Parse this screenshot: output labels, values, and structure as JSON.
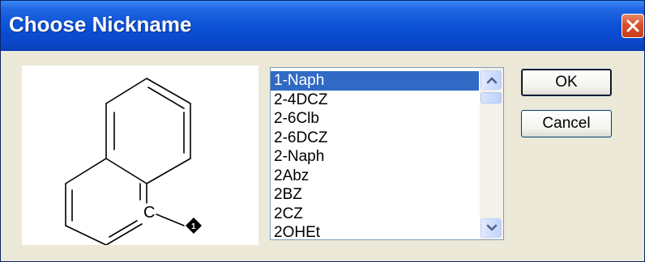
{
  "window": {
    "title": "Choose Nickname",
    "close_icon": "close-x-icon"
  },
  "preview": {
    "atom_label": "C",
    "attachment_marker": "1",
    "structure": "naphthalene with attachment point"
  },
  "list": {
    "items": [
      "1-Naph",
      "2-4DCZ",
      "2-6Clb",
      "2-6DCZ",
      "2-Naph",
      "2Abz",
      "2BZ",
      "2CZ",
      "2OHEt"
    ],
    "selected_index": 0
  },
  "buttons": {
    "ok": "OK",
    "cancel": "Cancel"
  },
  "colors": {
    "titlebar": "#0a4fd6",
    "selection": "#316ac5",
    "close": "#d9502a",
    "face": "#ece9d8"
  }
}
